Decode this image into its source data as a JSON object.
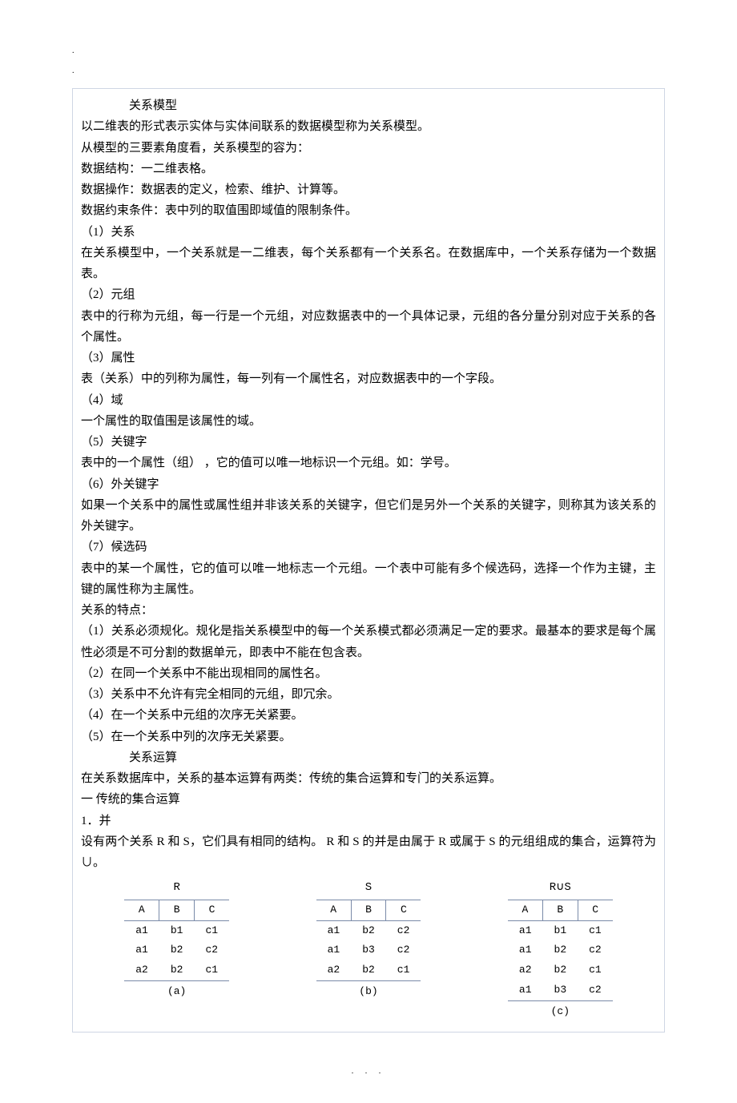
{
  "header_dots": ".",
  "title": "关系模型",
  "paragraphs": [
    "以二维表的形式表示实体与实体间联系的数据模型称为关系模型。",
    "从模型的三要素角度看，关系模型的容为：",
    "数据结构：一二维表格。",
    "数据操作：数据表的定义，检索、维护、计算等。",
    "数据约束条件：表中列的取值围即域值的限制条件。",
    "（1）关系",
    "在关系模型中，一个关系就是一二维表，每个关系都有一个关系名。在数据库中，一个关系存储为一个数据表。",
    "（2）元组",
    "表中的行称为元组，每一行是一个元组，对应数据表中的一个具体记录，元组的各分量分别对应于关系的各个属性。",
    "（3）属性",
    "表（关系）中的列称为属性，每一列有一个属性名，对应数据表中的一个字段。",
    "（4）域",
    "一个属性的取值围是该属性的域。",
    "（5）关键字",
    "表中的一个属性（组）  ，它的值可以唯一地标识一个元组。如：学号。",
    "（6）外关键字",
    "如果一个关系中的属性或属性组并非该关系的关键字，但它们是另外一个关系的关键字，则称其为该关系的外关键字。",
    "（7）候选码",
    "表中的某一个属性，它的值可以唯一地标志一个元组。一个表中可能有多个候选码，选择一个作为主键，主键的属性称为主属性。",
    "关系的特点：",
    "（1）关系必须规化。规化是指关系模型中的每一个关系模式都必须满足一定的要求。最基本的要求是每个属性必须是不可分割的数据单元，即表中不能在包含表。",
    "（2）在同一个关系中不能出现相同的属性名。",
    "（3）关系中不允许有完全相同的元组，即冗余。",
    "（4）在一个关系中元组的次序无关紧要。",
    "（5）在一个关系中列的次序无关紧要。"
  ],
  "section2_title": "关系运算",
  "section2_paragraphs": [
    "在关系数据库中，关系的基本运算有两类：传统的集合运算和专门的关系运算。",
    "一  传统的集合运算",
    "  1．并",
    "设有两个关系   R 和 S，它们具有相同的结构。   R 和 S 的并是由属于   R 或属于  S 的元组组成的集合，运算符为∪。"
  ],
  "tables": {
    "R": {
      "title": "R",
      "headers": [
        "A",
        "B",
        "C"
      ],
      "rows": [
        [
          "a1",
          "b1",
          "c1"
        ],
        [
          "a1",
          "b2",
          "c2"
        ],
        [
          "a2",
          "b2",
          "c1"
        ]
      ],
      "caption": "(a)"
    },
    "S": {
      "title": "S",
      "headers": [
        "A",
        "B",
        "C"
      ],
      "rows": [
        [
          "a1",
          "b2",
          "c2"
        ],
        [
          "a1",
          "b3",
          "c2"
        ],
        [
          "a2",
          "b2",
          "c1"
        ]
      ],
      "caption": "(b)"
    },
    "RUS": {
      "title": "R∪S",
      "headers": [
        "A",
        "B",
        "C"
      ],
      "rows": [
        [
          "a1",
          "b1",
          "c1"
        ],
        [
          "a1",
          "b2",
          "c2"
        ],
        [
          "a2",
          "b2",
          "c1"
        ],
        [
          "a1",
          "b3",
          "c2"
        ]
      ],
      "caption": "(c)"
    }
  },
  "footer": ".    .    ."
}
